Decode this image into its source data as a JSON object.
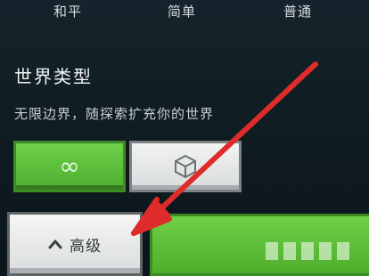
{
  "difficulty": {
    "options": [
      "和平",
      "简单",
      "普通"
    ]
  },
  "world_type": {
    "title": "世界类型",
    "description": "无限边界，随探索扩充你的世界",
    "options": [
      {
        "icon": "infinity-icon",
        "glyph": "∞",
        "selected": true
      },
      {
        "icon": "cube-icon",
        "selected": false
      }
    ]
  },
  "advanced": {
    "label": "高级",
    "icon": "chevron-up-icon"
  },
  "create": {
    "label": ""
  },
  "colors": {
    "accent_green": "#5cc03b",
    "annotation_red": "#e02b2b",
    "background": "#10181f"
  }
}
